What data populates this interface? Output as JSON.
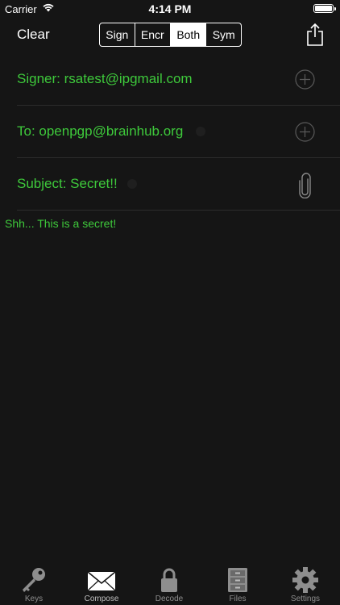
{
  "status_bar": {
    "carrier": "Carrier",
    "time": "4:14 PM"
  },
  "nav": {
    "clear_label": "Clear",
    "segments": [
      "Sign",
      "Encr",
      "Both",
      "Sym"
    ],
    "selected_segment": "Both"
  },
  "fields": {
    "signer": "Signer: rsatest@ipgmail.com",
    "to": "To: openpgp@brainhub.org",
    "subject": "Subject: Secret!!"
  },
  "message_body": "Shh... This is a secret!",
  "tabs": [
    {
      "label": "Keys",
      "icon": "key-icon"
    },
    {
      "label": "Compose",
      "icon": "envelope-icon"
    },
    {
      "label": "Decode",
      "icon": "lock-icon"
    },
    {
      "label": "Files",
      "icon": "file-cabinet-icon"
    },
    {
      "label": "Settings",
      "icon": "gear-icon"
    }
  ],
  "colors": {
    "accent_green": "#3ec93b",
    "background": "#151515"
  }
}
